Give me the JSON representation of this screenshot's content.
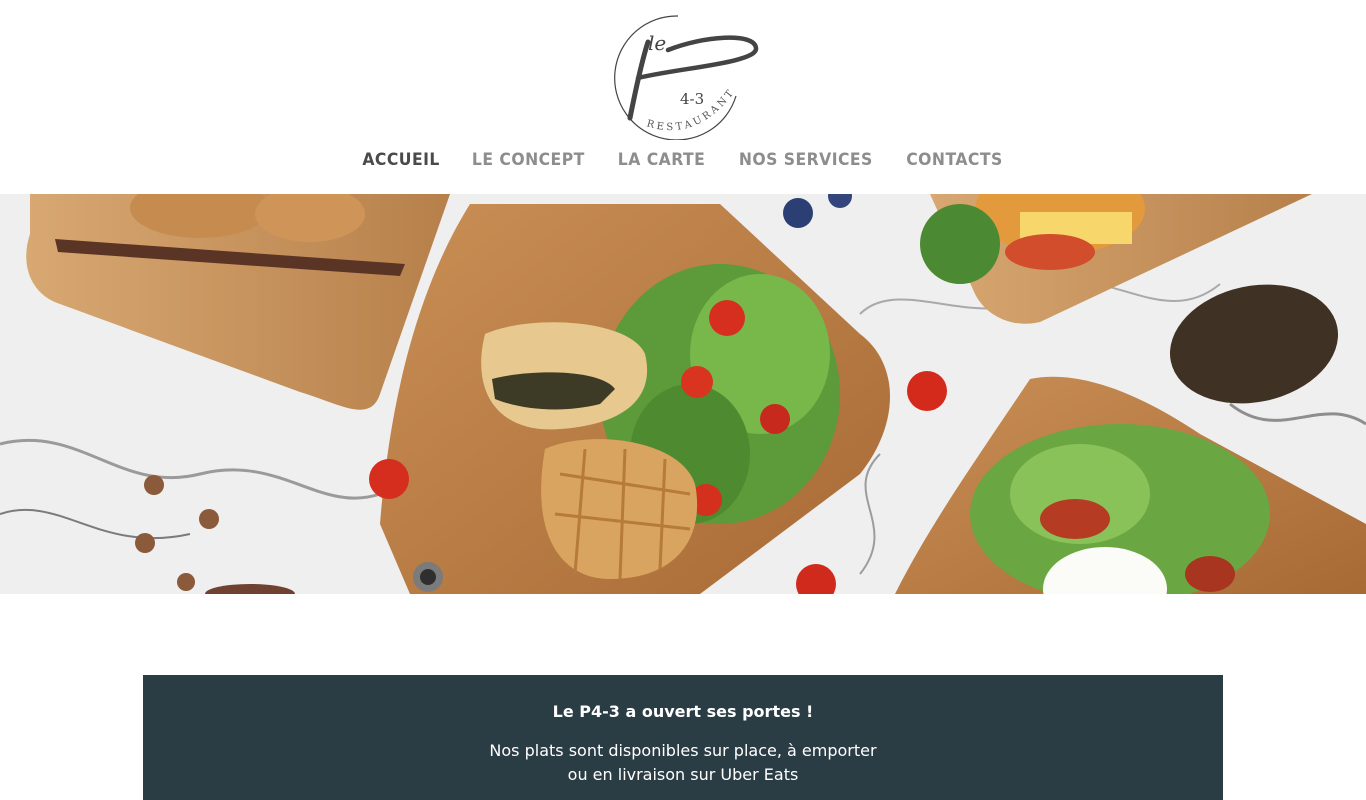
{
  "site": {
    "logo": {
      "top_text": "le",
      "bottom_text": "4-3",
      "curve_text": "RESTAURANT",
      "letter": "P"
    }
  },
  "nav": {
    "items": [
      {
        "label": "ACCUEIL",
        "active": true
      },
      {
        "label": "LE CONCEPT",
        "active": false
      },
      {
        "label": "LA CARTE",
        "active": false
      },
      {
        "label": "NOS SERVICES",
        "active": false
      },
      {
        "label": "CONTACTS",
        "active": false
      }
    ]
  },
  "hero": {
    "image": "food-boards-on-marble-photo"
  },
  "announcement": {
    "title": "Le P4-3 a ouvert ses portes !",
    "line1": "Nos plats sont disponibles sur place, à emporter",
    "line2": "ou en livraison sur Uber Eats"
  },
  "colors": {
    "banner_bg": "#2b3d44",
    "nav_active": "#4a4a4a",
    "nav_inactive": "#8d8d8d"
  }
}
